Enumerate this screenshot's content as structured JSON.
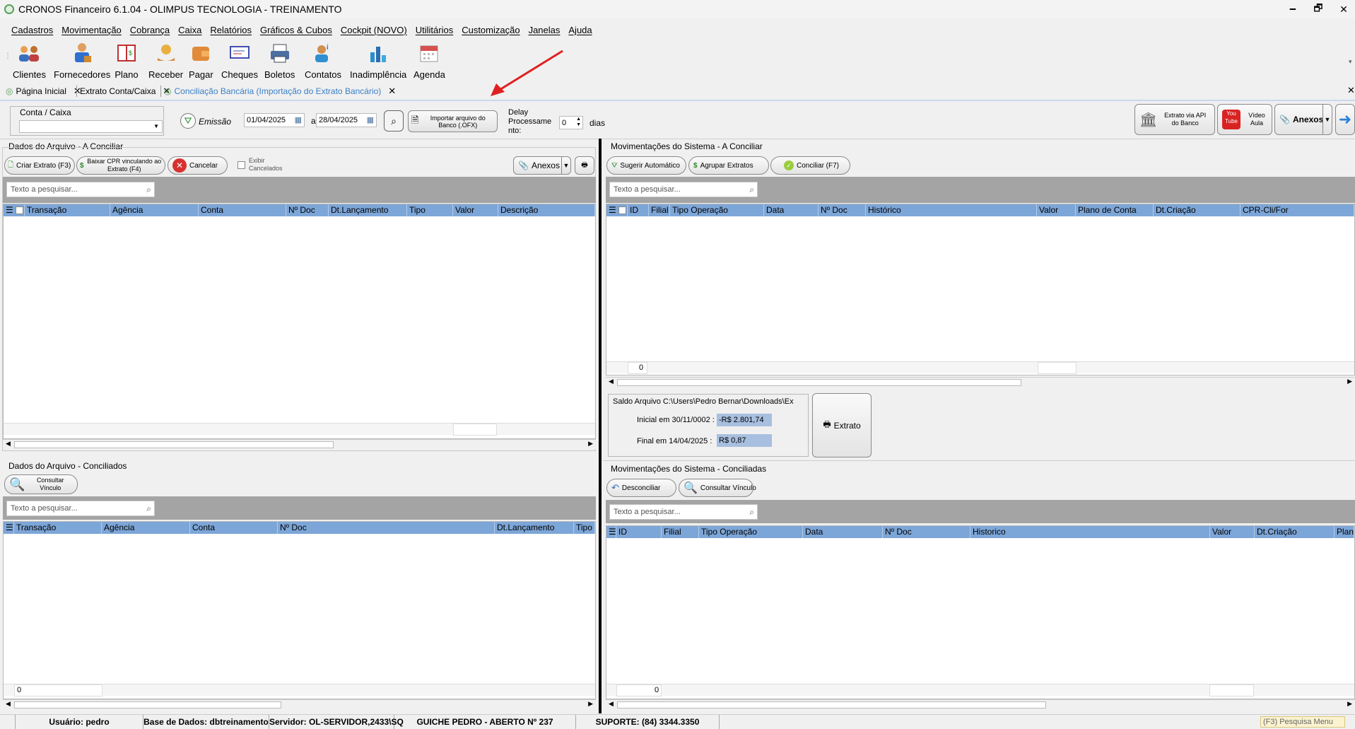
{
  "window": {
    "title": "CRONOS Financeiro 6.1.04 - OLIMPUS TECNOLOGIA - TREINAMENTO",
    "minimize": "🗕",
    "restore": "🗗",
    "close": "✕"
  },
  "menu": [
    "Cadastros",
    "Movimentação",
    "Cobrança",
    "Caixa",
    "Relatórios",
    "Gráficos & Cubos",
    "Cockpit (NOVO)",
    "Utilitários",
    "Customização",
    "Janelas",
    "Ajuda"
  ],
  "toolbar": [
    "Clientes",
    "Fornecedores",
    "Plano",
    "Receber",
    "Pagar",
    "Cheques",
    "Boletos",
    "Contatos",
    "Inadimplência",
    "Agenda"
  ],
  "tabs": [
    "Página Inicial",
    "Extrato Conta/Caixa",
    "Conciliação Bancária (Importação do Extrato Bancário)"
  ],
  "filters": {
    "conta_label": "Conta / Caixa",
    "emissao": "Emissão",
    "date_from": "01/04/2025",
    "date_sep": "a",
    "date_to": "28/04/2025",
    "importar": "Importar arquivo do Banco (.OFX)",
    "delay": "Delay Processame nto:",
    "delay_value": "0",
    "dias": "dias",
    "api": "Extrato via API do Banco",
    "video": "Vídeo Aula",
    "anexos": "Anexos"
  },
  "left_top": {
    "title": "Dados do Arquivo - A Conciliar",
    "btn_criar": "Criar Extrato (F3)",
    "btn_baixar": "Baixar CPR vinculando ao Extrato (F4)",
    "btn_cancelar": "Cancelar",
    "exibir": "Exibir Cancelados",
    "anexos": "Anexos",
    "search": "Texto a pesquisar...",
    "columns": [
      "Transação",
      "Agência",
      "Conta",
      "Nº Doc",
      "Dt.Lançamento",
      "Tipo",
      "Valor",
      "Descrição"
    ]
  },
  "left_bottom": {
    "title": "Dados do Arquivo - Conciliados",
    "btn_consultar": "Consultar Vínculo",
    "search": "Texto a pesquisar...",
    "columns": [
      "Transação",
      "Agência",
      "Conta",
      "Nº Doc",
      "Dt.Lançamento",
      "Tipo"
    ],
    "count": "0"
  },
  "right_top": {
    "title": "Movimentações do Sistema - A Conciliar",
    "btn_sugerir": "Sugerir Automático",
    "btn_agrupar": "Agrupar Extratos",
    "btn_conciliar": "Conciliar (F7)",
    "search": "Texto a pesquisar...",
    "columns": [
      "ID",
      "Filial",
      "Tipo Operação",
      "Data",
      "Nº Doc",
      "Histórico",
      "Valor",
      "Plano de Conta",
      "Dt.Criação",
      "CPR-Cli/For"
    ],
    "count": "0"
  },
  "saldo": {
    "title": "Saldo Arquivo C:\\Users\\Pedro Bernar\\Downloads\\Ex",
    "inicial_label": "Inicial em 30/11/0002 :",
    "inicial_value": "-R$ 2.801,74",
    "final_label": "Final em 14/04/2025 :",
    "final_value": "R$ 0,87",
    "extrato": "Extrato"
  },
  "right_bottom": {
    "title": "Movimentações do Sistema - Conciliadas",
    "btn_desconciliar": "Desconciliar",
    "btn_consultar": "Consultar Vínculo",
    "search": "Texto a pesquisar...",
    "columns": [
      "ID",
      "Filial",
      "Tipo Operação",
      "Data",
      "Nº Doc",
      "Historico",
      "Valor",
      "Dt.Criação",
      "Plano"
    ],
    "count": "0"
  },
  "status": {
    "usuario": "Usuário: pedro",
    "base": "Base de Dados: dbtreinamento",
    "servidor": "Servidor: OL-SERVIDOR,2433\\SQ",
    "guiche": "GUICHE PEDRO - ABERTO Nº 237",
    "suporte": "SUPORTE: (84) 3344.3350",
    "menu": "(F3) Pesquisa Menu"
  }
}
